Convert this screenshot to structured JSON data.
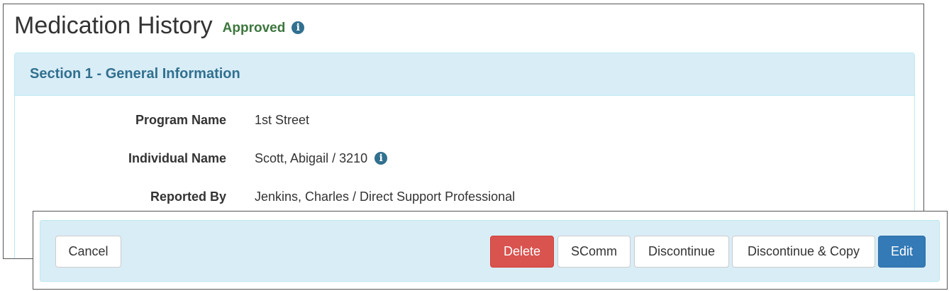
{
  "header": {
    "title": "Medication History",
    "status": "Approved",
    "status_color": "#3c763d",
    "info_icon": "info-circle-icon"
  },
  "section": {
    "title": "Section 1 - General Information",
    "fields": [
      {
        "label": "Program Name",
        "value": "1st Street"
      },
      {
        "label": "Individual Name",
        "value": "Scott, Abigail / 3210",
        "info_icon": "info-circle-icon"
      },
      {
        "label": "Reported By",
        "value": "Jenkins, Charles / Direct Support Professional"
      }
    ]
  },
  "actions": {
    "cancel": "Cancel",
    "delete": "Delete",
    "scomm": "SComm",
    "discontinue": "Discontinue",
    "discontinue_copy": "Discontinue & Copy",
    "edit": "Edit"
  },
  "colors": {
    "panel_bg": "#d9edf7",
    "panel_title": "#31708f",
    "delete_bg": "#d9534f",
    "edit_bg": "#337ab7"
  }
}
